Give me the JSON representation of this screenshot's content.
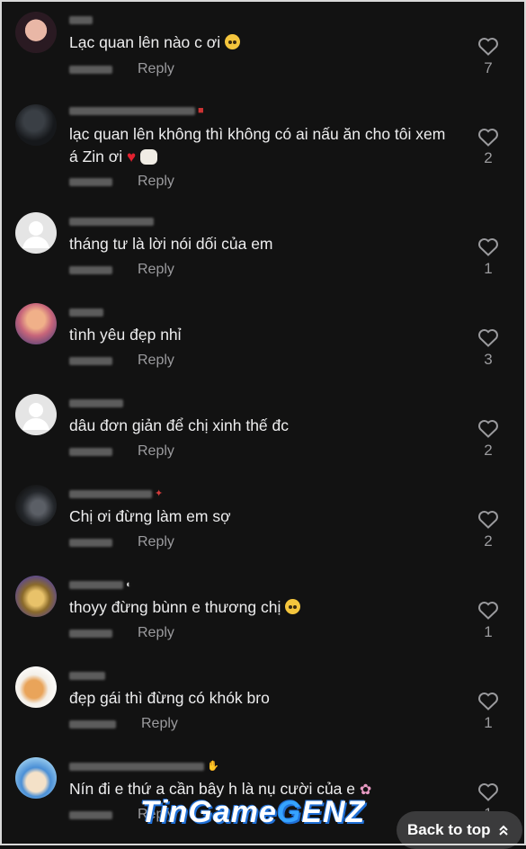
{
  "comments": [
    {
      "text": "Lạc quan lên nào c ơi",
      "reply": "Reply",
      "likes": "7",
      "emoji": "pleading-face"
    },
    {
      "text": "lạc quan lên không thì không có ai nấu ăn cho tôi xem á Zin ơi",
      "reply": "Reply",
      "likes": "2",
      "emoji": "red-heart+ram"
    },
    {
      "text": "tháng tư là lời nói dối của em",
      "reply": "Reply",
      "likes": "1"
    },
    {
      "text": "tình yêu đẹp nhỉ",
      "reply": "Reply",
      "likes": "3"
    },
    {
      "text": "dâu đơn giản để chị xinh thế đc",
      "reply": "Reply",
      "likes": "2"
    },
    {
      "text": "Chị ơi đừng làm em sợ",
      "reply": "Reply",
      "likes": "2"
    },
    {
      "text": "thoyy đừng bùnn e thương chị",
      "reply": "Reply",
      "likes": "1",
      "emoji": "pleading-face"
    },
    {
      "text": "đẹp gái thì đừng có khók bro",
      "reply": "Reply",
      "likes": "1"
    },
    {
      "text": "Nín đi e thứ a cần bây h là nụ cười của e",
      "reply": "Reply",
      "likes": "1",
      "emoji": "flower"
    }
  ],
  "watermark": {
    "part1": "TinGame",
    "part2": "G",
    "part3": "ENZ"
  },
  "back_to_top": "Back to top",
  "colors": {
    "background": "#121212",
    "text": "#f1f1f2",
    "muted": "#9b9b9e",
    "button": "#3b3b3c"
  }
}
